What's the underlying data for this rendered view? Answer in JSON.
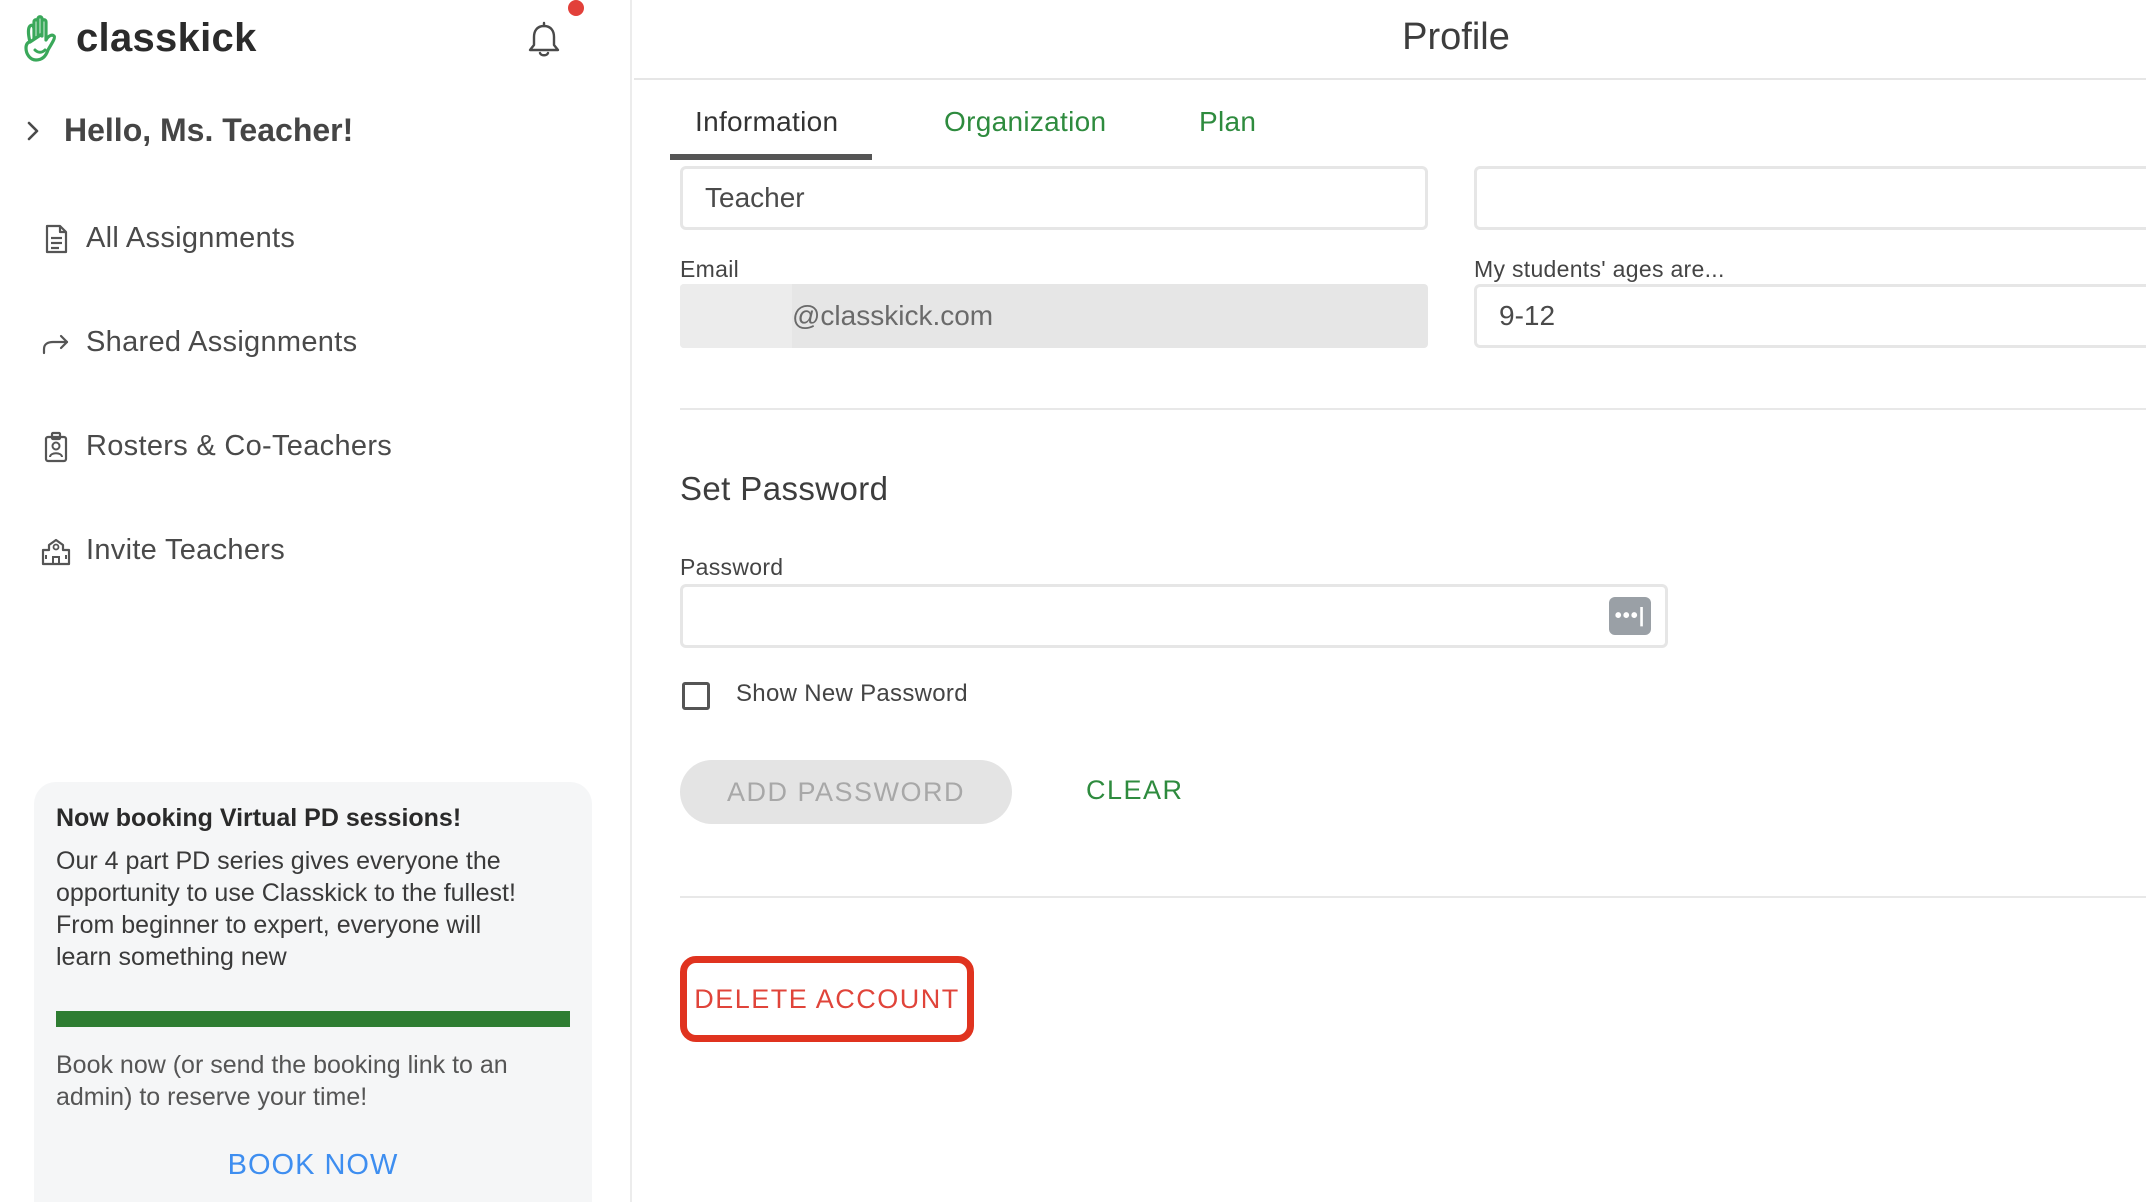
{
  "app": {
    "brand": "classkick"
  },
  "sidebar": {
    "greeting": "Hello, Ms. Teacher!",
    "items": [
      {
        "label": "All Assignments",
        "icon": "document-icon"
      },
      {
        "label": "Shared Assignments",
        "icon": "share-arrow-icon"
      },
      {
        "label": "Rosters & Co-Teachers",
        "icon": "roster-badge-icon"
      },
      {
        "label": "Invite Teachers",
        "icon": "school-building-icon"
      }
    ],
    "promo": {
      "title": "Now booking Virtual PD sessions!",
      "body_lines": [
        "Our 4 part PD series gives everyone the",
        "opportunity to use Classkick to the fullest!",
        "From beginner to expert, everyone will",
        "learn something new"
      ],
      "footer_lines": [
        "Book now (or send the booking link to an",
        "admin) to reserve your time!"
      ],
      "cta": "BOOK NOW"
    }
  },
  "main": {
    "title": "Profile",
    "tabs": [
      {
        "label": "Information",
        "active": true
      },
      {
        "label": "Organization",
        "active": false
      },
      {
        "label": "Plan",
        "active": false
      }
    ],
    "fields": {
      "last_name_value": "Teacher",
      "right_top_value": "",
      "email_label": "Email",
      "email_value": "@classkick.com",
      "ages_label": "My students' ages are...",
      "ages_value": "9-12"
    },
    "password_section": {
      "title": "Set Password",
      "password_label": "Password",
      "password_value": "",
      "show_label": "Show New Password",
      "add_button": "ADD PASSWORD",
      "clear_button": "CLEAR",
      "icon_glyph": "•••|"
    },
    "delete_button": "DELETE ACCOUNT"
  },
  "colors": {
    "accent_green": "#2e8b3e",
    "delete_red": "#e0331f",
    "link_blue": "#3e8ef0",
    "notification_red": "#e2403a"
  }
}
